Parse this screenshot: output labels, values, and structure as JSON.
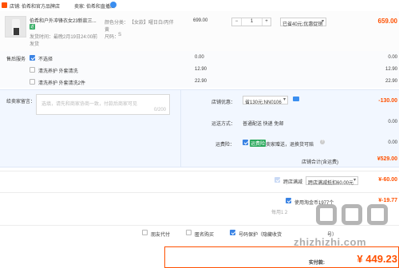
{
  "store": {
    "label": "店铺:",
    "name": "伯希和官方品牌店",
    "seller_label": "卖家:",
    "seller_name": "伯希和直播店"
  },
  "item": {
    "title": "伯希和户外冲锋衣女23新款三...",
    "badge": "返",
    "shipping_time_label": "发货时间：",
    "shipping_time": "最晚2月19日24:00前",
    "shipping_time_2": "发货",
    "color_label": "颜色分类：",
    "color_value": "【女款】曜日白/丙伴",
    "color_value_2": "黄",
    "size_label": "尺码：",
    "size_value": "S",
    "unit_price": "699.00",
    "qty_minus": "−",
    "qty": "1",
    "qty_plus": "+",
    "promo": "已省40元:优惠促销",
    "subtotal": "659.00"
  },
  "after_sales": {
    "label": "售后服务",
    "options": [
      {
        "label": "不选择",
        "price": "0.00",
        "total": "0.00"
      },
      {
        "label": "清洗养护 外套清洗",
        "price": "12.90",
        "total": "12.90"
      },
      {
        "label": "清洗养护 外套清洗2件",
        "price": "22.90",
        "total": "22.90"
      }
    ]
  },
  "message": {
    "label": "给卖家留言：",
    "placeholder": "选填，请先和商家协商一致，付款后商家可见",
    "counter": "0/200"
  },
  "coupon": {
    "label": "店铺优惠：",
    "value": "省130元:NN0106",
    "amount": "-130.00"
  },
  "delivery": {
    "label": "运送方式：",
    "value": "普通配送 快递 免邮",
    "amount": "0.00"
  },
  "insurance": {
    "label": "运费险：",
    "tag": "运费险",
    "text": "卖家赠送，退换货可赔",
    "amount": "0.00"
  },
  "store_total": {
    "label": "店铺合计(含运费)",
    "amount": "¥529.00"
  },
  "cross_store": {
    "label": "跨店满减",
    "value": "跨店满减抵扣60.00元",
    "amount": "¥-60.00"
  },
  "taojinbi": {
    "label": "使用淘金币1977个",
    "sub": "每用1２",
    "amount": "¥-19.77"
  },
  "options_bar": {
    "anonymous_pay": "朋友代付",
    "anonymous_buy": "匿名购买",
    "number_protect": "号码保护（隐藏收货",
    "number_protect_tail": "号）"
  },
  "pay": {
    "label": "实付款:",
    "amount": "¥ 449.23"
  },
  "watermark": "zhizhizhi.com"
}
